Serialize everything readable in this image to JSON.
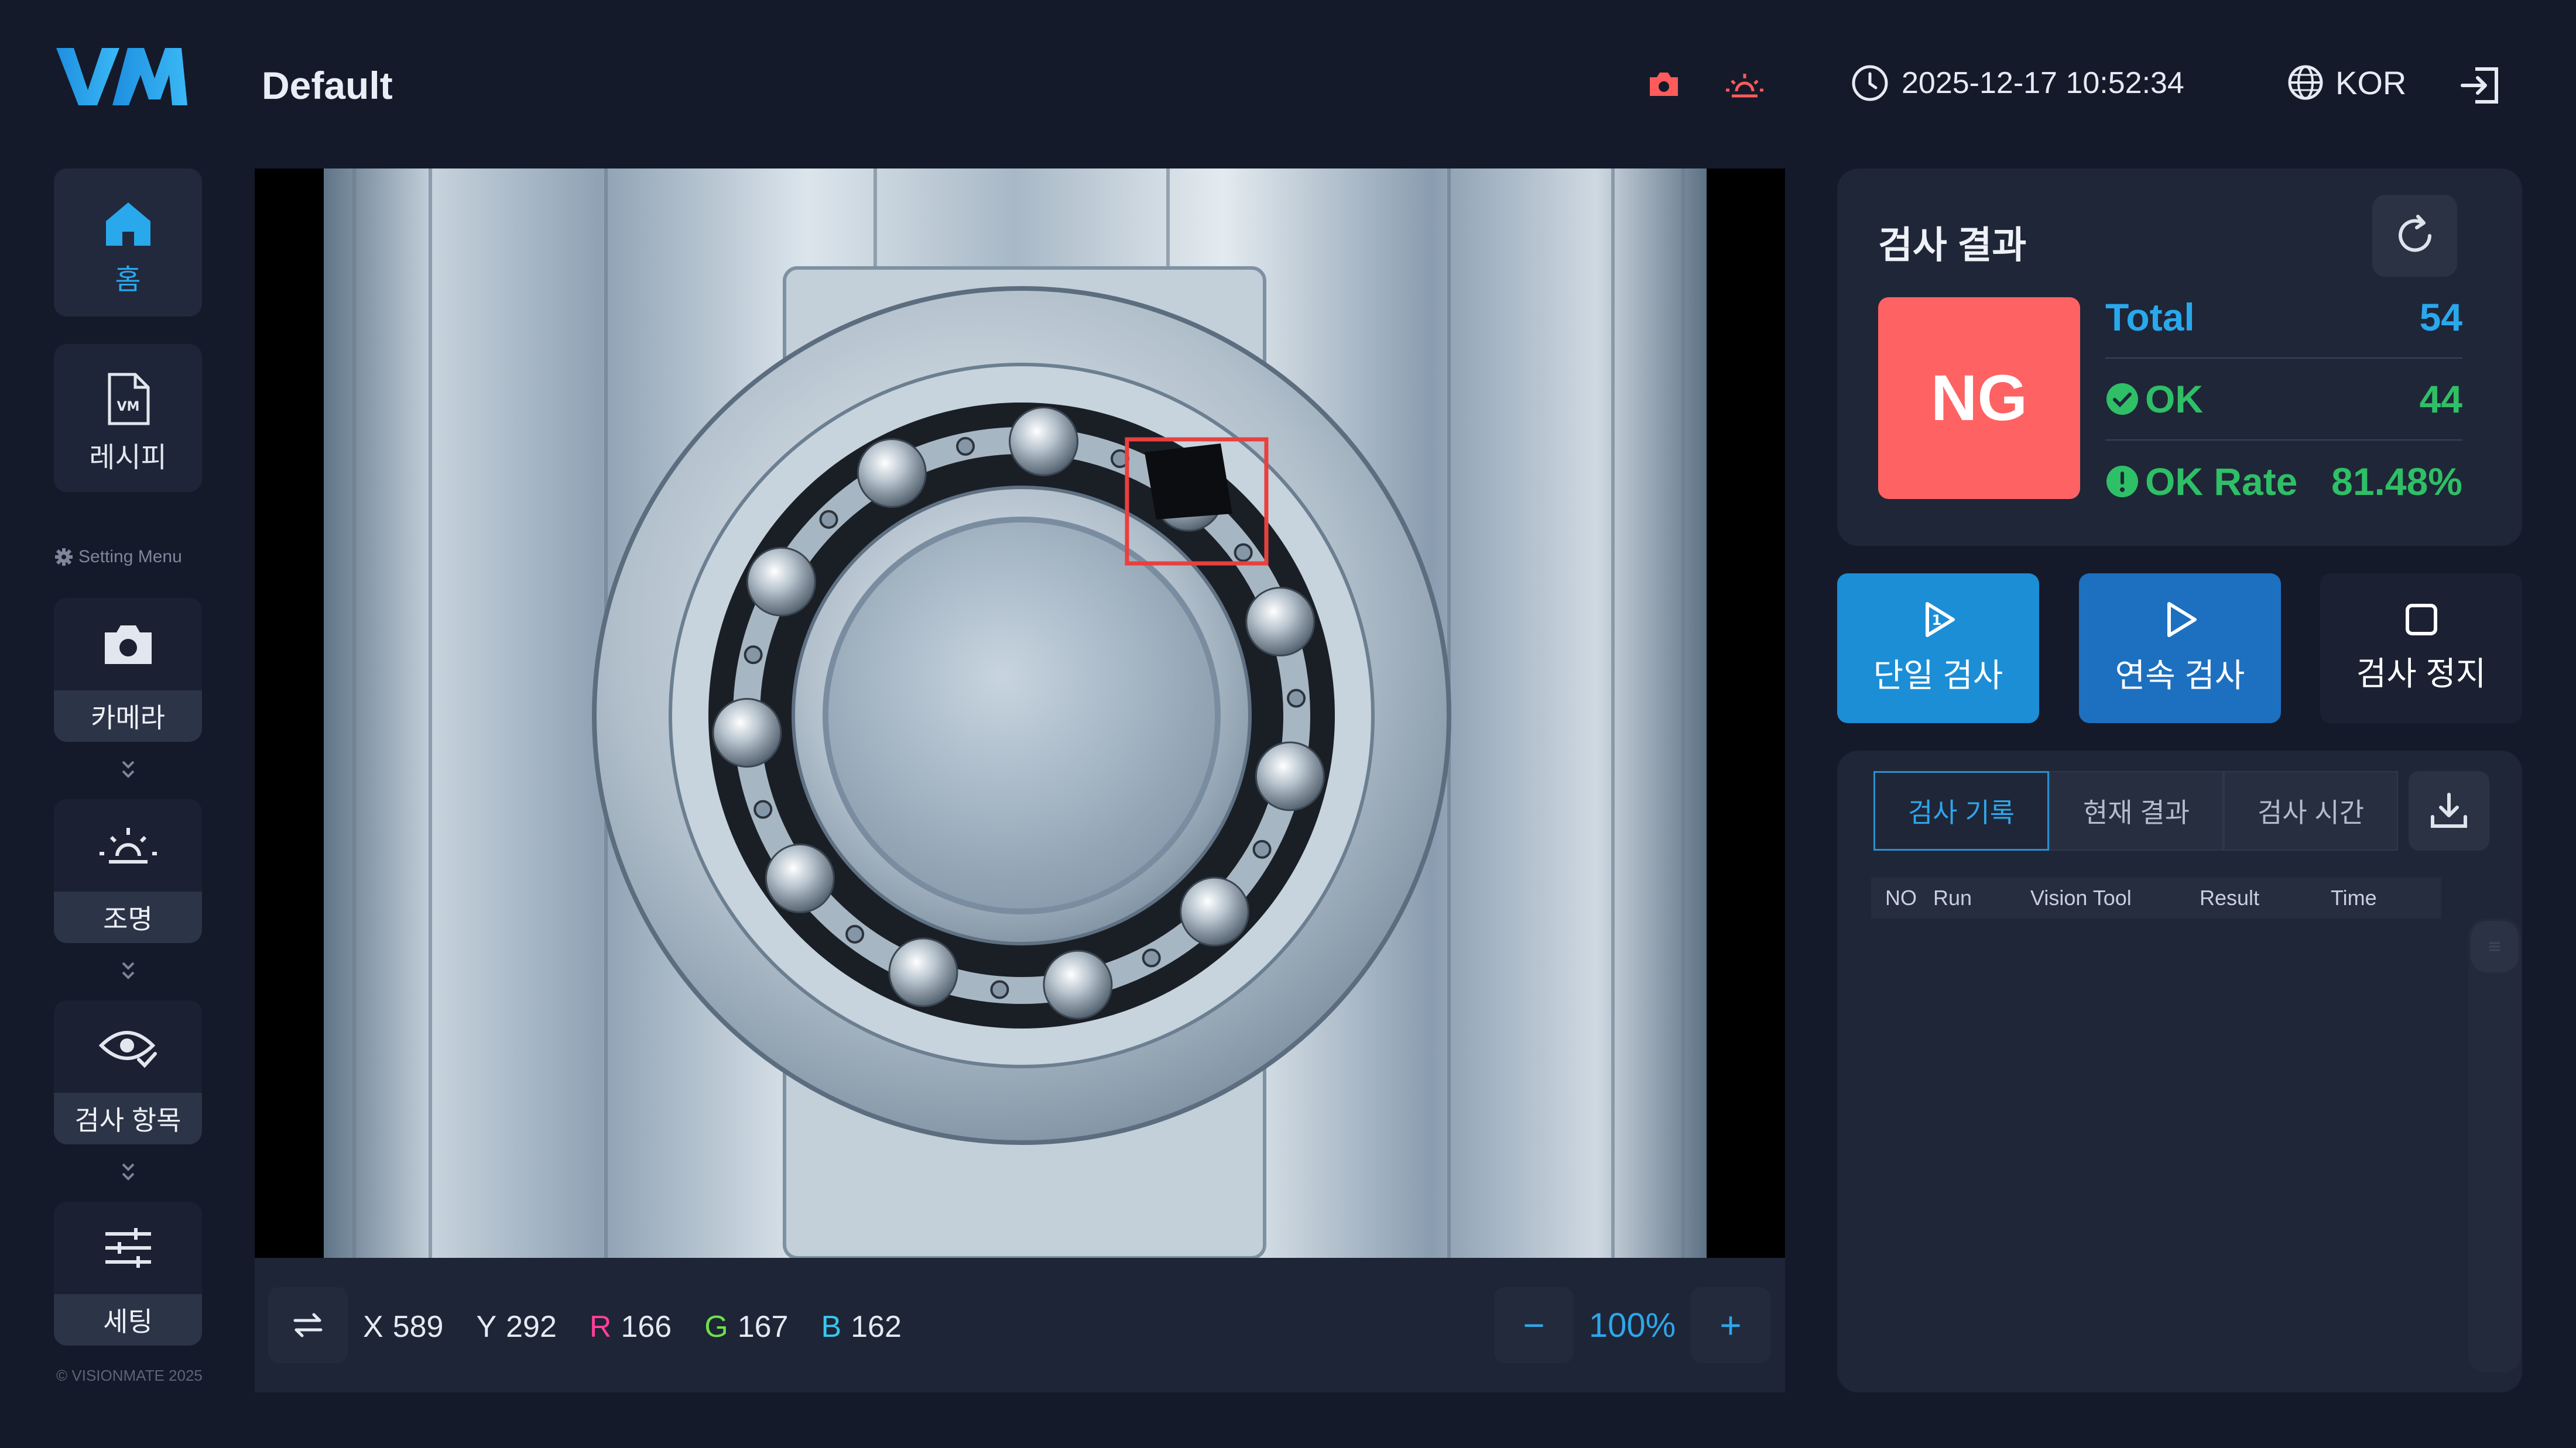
{
  "header": {
    "logo_text": "VM",
    "title": "Default",
    "datetime": "2025-12-17 10:52:34",
    "language": "KOR",
    "camera_icon": "camera-icon",
    "light_icon": "light-icon",
    "clock_icon": "clock-icon",
    "globe_icon": "globe-icon",
    "logout_icon": "logout-icon",
    "status_color": "#ff5b5b"
  },
  "sidebar": {
    "home": "홈",
    "recipe": "레시피",
    "setting_menu": "Setting Menu",
    "steps": [
      {
        "label": "카메라",
        "icon": "camera-icon"
      },
      {
        "label": "조명",
        "icon": "light-icon"
      },
      {
        "label": "검사 항목",
        "icon": "eye-check-icon"
      },
      {
        "label": "세팅",
        "icon": "sliders-icon"
      }
    ],
    "copyright": "© VISIONMATE 2025"
  },
  "viewer": {
    "image_subject": "ball bearing",
    "defect_box_color": "#e8403e",
    "pixel": {
      "x_label": "X",
      "x": "589",
      "y_label": "Y",
      "y": "292",
      "r_label": "R",
      "r": "166",
      "g_label": "G",
      "g": "167",
      "b_label": "B",
      "b": "162"
    },
    "zoom": "100%",
    "zoom_minus": "−",
    "zoom_plus": "+"
  },
  "result": {
    "title": "검사 결과",
    "status": "NG",
    "status_color": "#ff6262",
    "total_label": "Total",
    "total_value": "54",
    "ok_label": "OK",
    "ok_value": "44",
    "rate_label": "OK Rate",
    "rate_value": "81.48%",
    "accent": "#29a8ec",
    "ok_color": "#2fbf66"
  },
  "actions": {
    "single": "단일 검사",
    "continuous": "연속 검사",
    "stop": "검사 정지"
  },
  "records": {
    "tabs": [
      "검사 기록",
      "현재 결과",
      "검사 시간"
    ],
    "columns": [
      "NO",
      "Run",
      "Vision Tool",
      "Result",
      "Time"
    ]
  }
}
